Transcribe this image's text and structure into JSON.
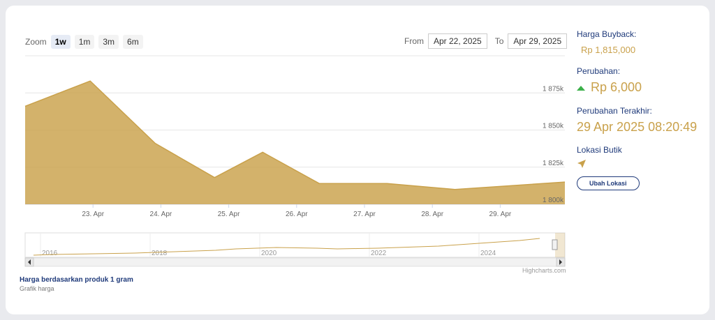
{
  "toolbar": {
    "zoom_label": "Zoom",
    "zoom_options": [
      "1w",
      "1m",
      "3m",
      "6m"
    ],
    "active_zoom": "1w",
    "from_label": "From",
    "from_value": "Apr 22, 2025",
    "to_label": "To",
    "to_value": "Apr 29, 2025"
  },
  "chart_data": {
    "type": "area",
    "x": [
      "Apr 22 00:00",
      "Apr 22 23:00",
      "Apr 23 22:00",
      "Apr 24 19:00",
      "Apr 25 12:00",
      "Apr 26 08:00",
      "Apr 27 08:00",
      "Apr 28 08:00",
      "Apr 29 08:00"
    ],
    "values": [
      1866,
      1883,
      1841,
      1818,
      1835,
      1814,
      1814,
      1810,
      1815
    ],
    "xticks": [
      "23. Apr",
      "24. Apr",
      "25. Apr",
      "26. Apr",
      "27. Apr",
      "28. Apr",
      "29. Apr"
    ],
    "yticks": [
      "1 875k",
      "1 850k",
      "1 825k",
      "1 800k"
    ],
    "ylim": [
      1800,
      1900
    ],
    "navigator_years": [
      "2016",
      "2018",
      "2020",
      "2022",
      "2024"
    ],
    "color": "#c9a14b",
    "credit": "Highcharts.com"
  },
  "sidebar": {
    "buyback_label": "Harga Buyback:",
    "buyback_value": "Rp 1,815,000",
    "change_label": "Perubahan:",
    "change_value": "Rp 6,000",
    "last_change_label": "Perubahan Terakhir:",
    "last_change_value": "29 Apr 2025 08:20:49",
    "location_label": "Lokasi Butik",
    "location_button": "Ubah Lokasi"
  },
  "footer": {
    "title": "Harga berdasarkan produk 1 gram",
    "subtitle": "Grafik harga"
  }
}
